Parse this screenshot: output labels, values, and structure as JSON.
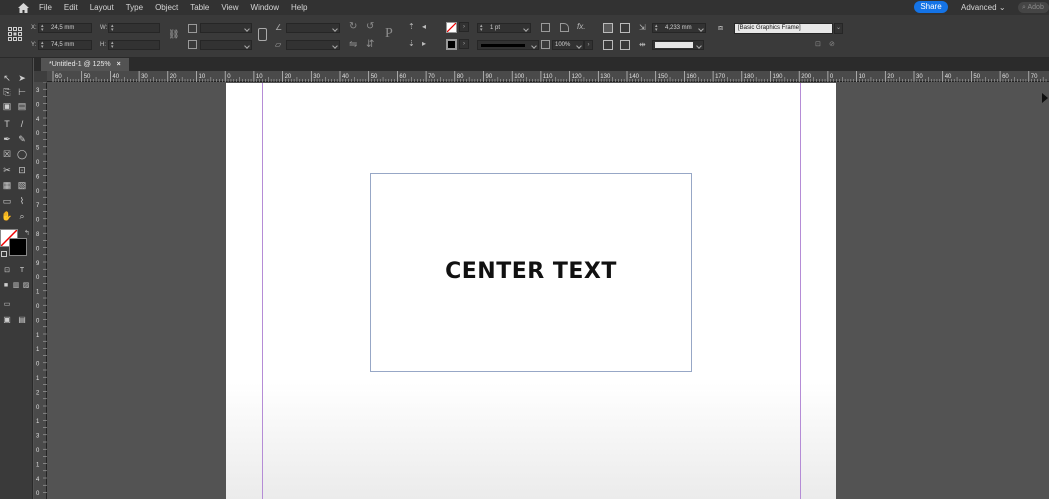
{
  "menubar": {
    "items": [
      "File",
      "Edit",
      "Layout",
      "Type",
      "Object",
      "Table",
      "View",
      "Window",
      "Help"
    ],
    "share_label": "Share",
    "workspace_label": "Advanced",
    "search_placeholder": "Adob"
  },
  "control_panel": {
    "x_label": "X:",
    "x_value": "24,5 mm",
    "y_label": "Y:",
    "y_value": "74,5 mm",
    "w_label": "W:",
    "h_label": "H:",
    "stroke_weight": "1 pt",
    "opacity": "100%",
    "frame_dimension": "4,233 mm",
    "object_style": "[Basic Graphics Frame]"
  },
  "document": {
    "tab_title": "*Untitled-1 @ 125%",
    "close_glyph": "×"
  },
  "ruler": {
    "horizontal_labels": [
      "60",
      "50",
      "40",
      "30",
      "20",
      "10",
      "0",
      "10",
      "20",
      "30",
      "40",
      "50",
      "60",
      "70",
      "80",
      "90",
      "100",
      "110",
      "120",
      "130",
      "140",
      "150",
      "160",
      "170",
      "180",
      "190",
      "200",
      "0",
      "10",
      "20",
      "30",
      "40",
      "50",
      "60",
      "70"
    ],
    "vertical_labels": [
      "3",
      "0",
      "4",
      "0",
      "5",
      "0",
      "6",
      "0",
      "7",
      "0",
      "8",
      "0",
      "9",
      "0",
      "1",
      "0",
      "0",
      "1",
      "1",
      "0",
      "1",
      "2",
      "0",
      "1",
      "3",
      "0",
      "1",
      "4",
      "0"
    ]
  },
  "canvas": {
    "frame_text": "CENTER TEXT"
  }
}
